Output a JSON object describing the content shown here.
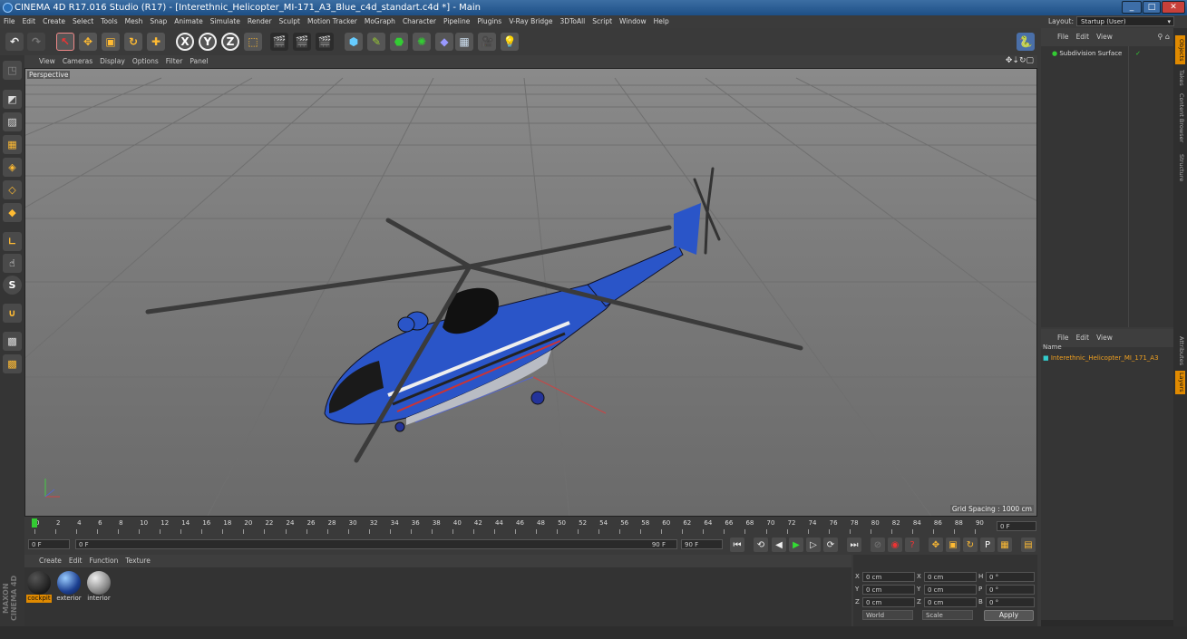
{
  "window": {
    "title": "CINEMA 4D R17.016 Studio (R17) - [Interethnic_Helicopter_MI-171_A3_Blue_c4d_standart.c4d *] - Main",
    "minimize": "_",
    "maximize": "□",
    "close": "✕"
  },
  "menubar": {
    "items": [
      "File",
      "Edit",
      "Create",
      "Select",
      "Tools",
      "Mesh",
      "Snap",
      "Animate",
      "Simulate",
      "Render",
      "Sculpt",
      "Motion Tracker",
      "MoGraph",
      "Character",
      "Pipeline",
      "Plugins",
      "V-Ray Bridge",
      "3DToAll",
      "Script",
      "Window",
      "Help"
    ],
    "layout_label": "Layout:",
    "layout_value": "Startup (User)"
  },
  "toolbar": {
    "axes": [
      "X",
      "Y",
      "Z"
    ]
  },
  "viewport": {
    "menu": [
      "View",
      "Cameras",
      "Display",
      "Options",
      "Filter",
      "Panel"
    ],
    "label": "Perspective",
    "grid_spacing": "Grid Spacing : 1000 cm"
  },
  "timeline": {
    "ticks": [
      "0",
      "2",
      "4",
      "6",
      "8",
      "10",
      "12",
      "14",
      "16",
      "18",
      "20",
      "22",
      "24",
      "26",
      "28",
      "30",
      "32",
      "34",
      "36",
      "38",
      "40",
      "42",
      "44",
      "46",
      "48",
      "50",
      "52",
      "54",
      "56",
      "58",
      "60",
      "62",
      "64",
      "66",
      "68",
      "70",
      "72",
      "74",
      "76",
      "78",
      "80",
      "82",
      "84",
      "86",
      "88",
      "90"
    ],
    "current_frame": "0 F"
  },
  "playback": {
    "start": "0 F",
    "slider_start": "0 F",
    "slider_end": "90 F",
    "end": "90 F"
  },
  "materials": {
    "menu": [
      "Create",
      "Edit",
      "Function",
      "Texture"
    ],
    "items": [
      {
        "name": "cockpit",
        "color": "#111111"
      },
      {
        "name": "exterior",
        "color": "#2a5fb0"
      },
      {
        "name": "interior",
        "color": "#9a9a9a"
      }
    ]
  },
  "coords": {
    "rows": [
      {
        "a": "X",
        "av": "0 cm",
        "b": "X",
        "bv": "0 cm",
        "c": "H",
        "cv": "0 °"
      },
      {
        "a": "Y",
        "av": "0 cm",
        "b": "Y",
        "bv": "0 cm",
        "c": "P",
        "cv": "0 °"
      },
      {
        "a": "Z",
        "av": "0 cm",
        "b": "Z",
        "bv": "0 cm",
        "c": "B",
        "cv": "0 °"
      }
    ],
    "world": "World",
    "scale": "Scale",
    "apply": "Apply"
  },
  "object_manager": {
    "menu": [
      "File",
      "Edit",
      "View"
    ],
    "item": "Subdivision Surface"
  },
  "attr_manager": {
    "menu": [
      "File",
      "Edit",
      "View"
    ],
    "column": "Name",
    "item": "Interethnic_Helicopter_MI_171_A3"
  },
  "right_tabs": [
    "Objects",
    "Takes",
    "Content Browser",
    "Structure",
    "Attributes",
    "Layers"
  ],
  "branding": "MAXON CINEMA 4D"
}
